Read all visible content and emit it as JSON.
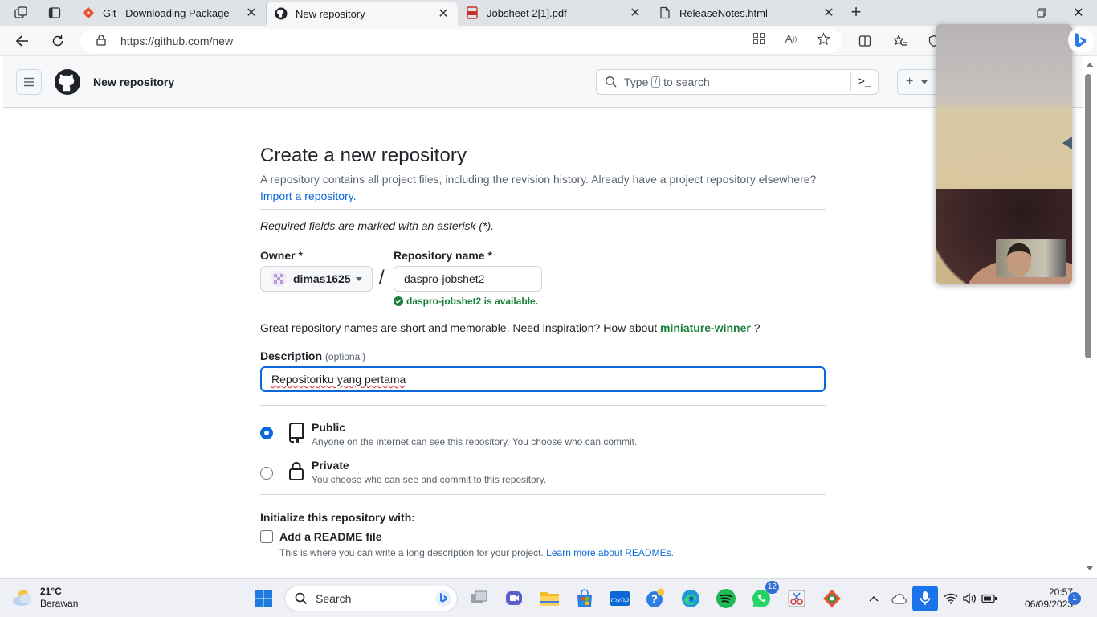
{
  "browser": {
    "tabs": [
      {
        "title": "Git - Downloading Package",
        "icon": "git-icon"
      },
      {
        "title": "New repository",
        "icon": "github-icon",
        "active": true
      },
      {
        "title": "Jobsheet 2[1].pdf",
        "icon": "pdf-icon"
      },
      {
        "title": "ReleaseNotes.html",
        "icon": "document-icon"
      }
    ],
    "url": "https://github.com/new"
  },
  "header": {
    "title": "New repository",
    "search_placeholder_pre": "Type",
    "search_key": "/",
    "search_placeholder_post": "to search",
    "command_glyph": ">_",
    "plus": "+"
  },
  "form": {
    "heading": "Create a new repository",
    "lead": "A repository contains all project files, including the revision history. Already have a project repository elsewhere?",
    "import_link": "Import a repository.",
    "required_note": "Required fields are marked with an asterisk (*).",
    "owner_label": "Owner *",
    "owner_value": "dimas1625",
    "slash": "/",
    "repo_label": "Repository name *",
    "repo_value": "daspro-jobshet2",
    "availability": "daspro-jobshet2 is available.",
    "inspiration_pre": "Great repository names are short and memorable. Need inspiration? How about",
    "suggestion": "miniature-winner",
    "inspiration_post": "?",
    "description_label": "Description",
    "description_optional": "(optional)",
    "description_value": "Repositoriku yang pertama",
    "visibility": [
      {
        "title": "Public",
        "desc": "Anyone on the internet can see this repository. You choose who can commit.",
        "selected": true
      },
      {
        "title": "Private",
        "desc": "You choose who can see and commit to this repository.",
        "selected": false
      }
    ],
    "init_heading": "Initialize this repository with:",
    "readme_label": "Add a README file",
    "readme_desc": "This is where you can write a long description for your project.",
    "readme_link": "Learn more about READMEs."
  },
  "taskbar": {
    "weather_temp": "21°C",
    "weather_desc": "Berawan",
    "search_label": "Search",
    "whatsapp_badge": "12",
    "time": "20:57",
    "date": "06/09/2023",
    "notifications": "1"
  },
  "colors": {
    "accent": "#0969da",
    "success": "#1a7f37",
    "border": "#d0d7de"
  }
}
